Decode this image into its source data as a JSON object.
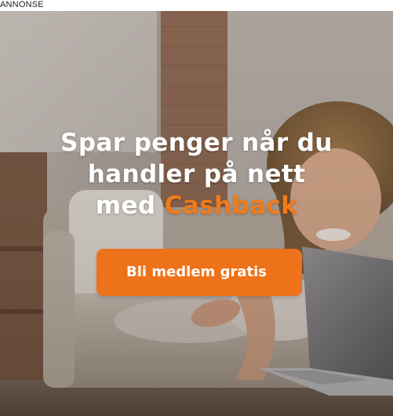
{
  "ad": {
    "label": "ANNONSE"
  },
  "banner": {
    "headline_line1": "Spar penger når du",
    "headline_line2": "handler på nett",
    "headline_line3_prefix": "med ",
    "headline_line3_accent": "Cashback",
    "cta_label": "Bli medlem gratis"
  },
  "colors": {
    "accent": "#ee7219",
    "headline_text": "#ffffff"
  }
}
